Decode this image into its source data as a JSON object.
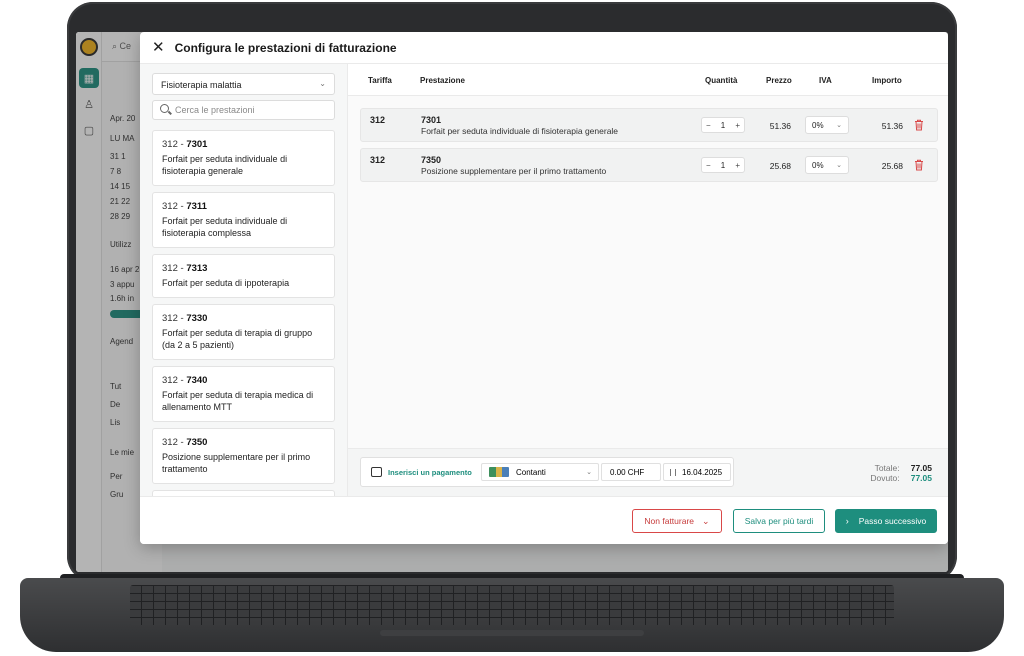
{
  "background_app": {
    "search_hint": "Ce",
    "side_texts": [
      "Apr. 20",
      "LU  MA",
      "31   1",
      "7    8",
      "14  15",
      "21  22",
      "28  29",
      "Utilizz",
      "16 apr 2",
      "3 appu",
      "1.6h in",
      "Agend",
      "Tut",
      "De",
      "Lis",
      "Le mie",
      "Per",
      "Gru"
    ]
  },
  "modal": {
    "title": "Configura le prestazioni di fatturazione",
    "type_select": "Fisioterapia malattia",
    "search_placeholder": "Cerca le prestazioni",
    "services": [
      {
        "tariff": "312",
        "code": "7301",
        "desc": "Forfait per seduta individuale di fisioterapia generale"
      },
      {
        "tariff": "312",
        "code": "7311",
        "desc": "Forfait per seduta individuale di fisioterapia complessa"
      },
      {
        "tariff": "312",
        "code": "7313",
        "desc": "Forfait per seduta di ippoterapia"
      },
      {
        "tariff": "312",
        "code": "7330",
        "desc": "Forfait per seduta di terapia di gruppo (da 2 a 5 pazienti)"
      },
      {
        "tariff": "312",
        "code": "7340",
        "desc": "Forfait per seduta di terapia medica di allenamento MTT"
      },
      {
        "tariff": "312",
        "code": "7350",
        "desc": "Posizione supplementare per il primo trattamento"
      }
    ],
    "table": {
      "headers": {
        "tariff": "Tariffa",
        "service": "Prestazione",
        "qty": "Quantità",
        "price": "Prezzo",
        "vat": "IVA",
        "amount": "Importo"
      },
      "rows": [
        {
          "tariff": "312",
          "code": "7301",
          "desc": "Forfait per seduta individuale di fisioterapia generale",
          "qty": "1",
          "price": "51.36",
          "vat": "0%",
          "amount": "51.36"
        },
        {
          "tariff": "312",
          "code": "7350",
          "desc": "Posizione supplementare per il primo trattamento",
          "qty": "1",
          "price": "25.68",
          "vat": "0%",
          "amount": "25.68"
        }
      ]
    },
    "payment": {
      "insert_label": "Inserisci un pagamento",
      "method": "Contanti",
      "amount": "0.00 CHF",
      "date": "16.04.2025"
    },
    "totals": {
      "total_label": "Totale:",
      "total_value": "77.05",
      "due_label": "Dovuto:",
      "due_value": "77.05"
    },
    "buttons": {
      "no_invoice": "Non fatturare",
      "save_later": "Salva per più tardi",
      "next_step": "Passo successivo"
    }
  },
  "colors": {
    "accent": "#1e8e7e",
    "danger": "#d94848",
    "frame": "#2b2c2e"
  }
}
